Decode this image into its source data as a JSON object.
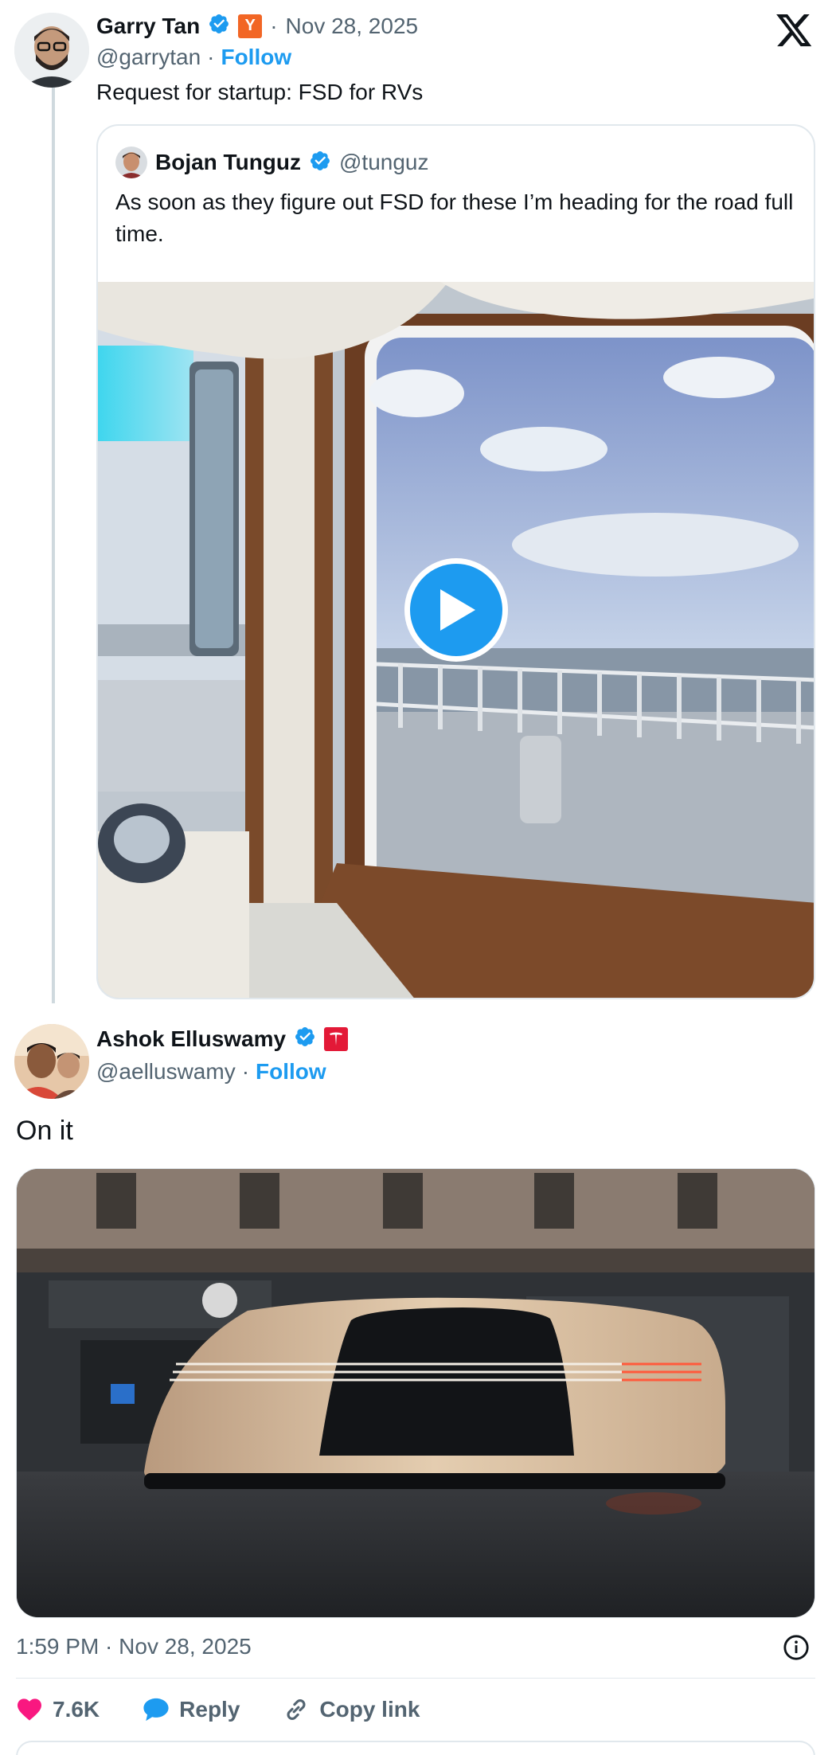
{
  "tweet": {
    "author_name": "Garry Tan",
    "handle": "@garrytan",
    "separator": "·",
    "date": "Nov 28, 2025",
    "follow_label": "Follow",
    "badge_letter": "Y",
    "text": "Request for startup: FSD for RVs",
    "badge_color": "#f26625"
  },
  "quote": {
    "author_name": "Bojan Tunguz",
    "handle": "@tunguz",
    "text": "As soon as they figure out FSD for these I’m heading for the road full time.",
    "media": "video",
    "play_icon": "play-icon"
  },
  "reply": {
    "author_name": "Ashok Elluswamy",
    "handle": "@aelluswamy",
    "separator": "·",
    "follow_label": "Follow",
    "text": "On it",
    "badge_color": "#e31937",
    "timestamp": "1:59 PM · Nov 28, 2025",
    "media": "image"
  },
  "actions": {
    "likes": "7.6K",
    "reply_label": "Reply",
    "copy_label": "Copy link"
  },
  "icons": {
    "brand": "x-logo-icon",
    "verified": "verified-badge-icon",
    "info": "info-icon",
    "like": "heart-icon",
    "reply": "speech-bubble-icon",
    "copy": "link-icon"
  },
  "colors": {
    "accent": "#1d9bf0",
    "like": "#f91880",
    "text": "#0f1419",
    "muted": "#536471"
  }
}
